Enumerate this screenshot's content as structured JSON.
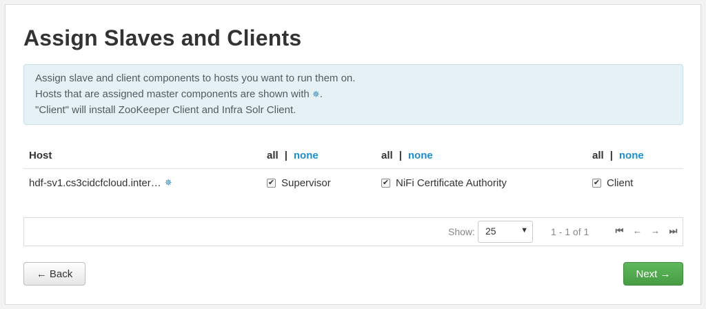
{
  "page": {
    "title": "Assign Slaves and Clients"
  },
  "info": {
    "line1": "Assign slave and client components to hosts you want to run them on.",
    "line2_prefix": "Hosts that are assigned master components are shown with",
    "line2_suffix": ".",
    "line3": "\"Client\" will install ZooKeeper Client and Infra Solr Client."
  },
  "table": {
    "host_header": "Host",
    "all_label": "all",
    "sep": "|",
    "none_label": "none",
    "rows": [
      {
        "host": "hdf-sv1.cs3cidcfcloud.inter…",
        "components": [
          {
            "label": "Supervisor",
            "checked": true
          },
          {
            "label": "NiFi Certificate Authority",
            "checked": true
          },
          {
            "label": "Client",
            "checked": true
          }
        ]
      }
    ]
  },
  "pager": {
    "show_label": "Show:",
    "page_size": "25",
    "range": "1 - 1 of 1"
  },
  "buttons": {
    "back": "← Back",
    "next": "Next →"
  },
  "icons": {
    "master": "master-component-star-icon",
    "checkbox_mark": "✔"
  },
  "colors": {
    "link": "#1a8ec9",
    "info_bg": "#e6f1f6",
    "next_btn": "#4cae4c"
  }
}
